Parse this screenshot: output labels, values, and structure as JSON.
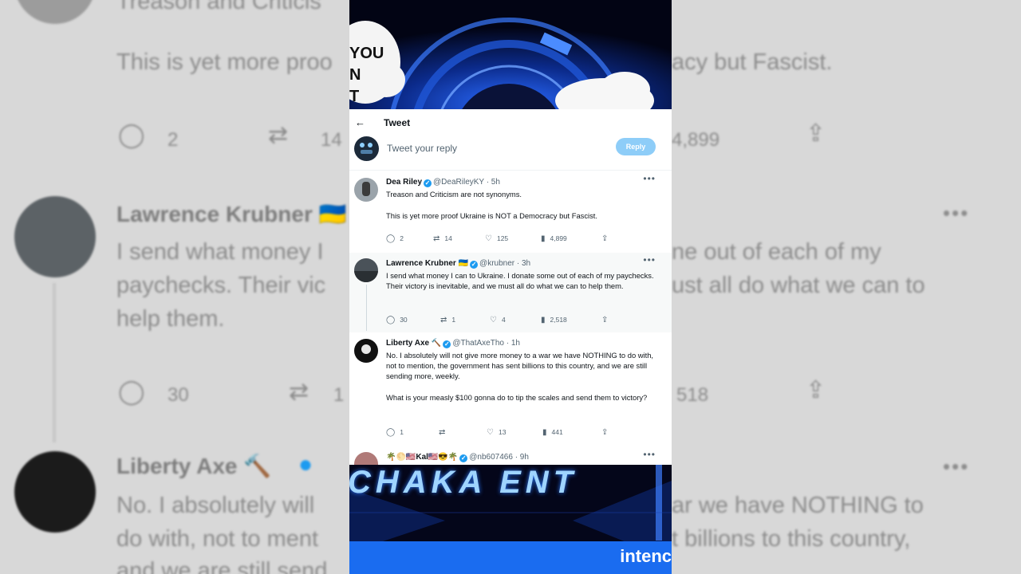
{
  "header": {
    "title": "Tweet",
    "back_icon": "arrow-left-icon"
  },
  "reply": {
    "placeholder": "Tweet your reply",
    "button_label": "Reply",
    "button_color": "#8ecdf8"
  },
  "tweets": [
    {
      "name": "Dea Riley",
      "handle": "@DeaRileyKY · 5h",
      "text_1": "Treason and Criticism are not synonyms.",
      "text_2": "This is yet more proof Ukraine is NOT a Democracy but Fascist.",
      "replies": "2",
      "retweets": "14",
      "likes": "125",
      "views": "4,899"
    },
    {
      "name": "Lawrence Krubner 🇺🇦",
      "handle": "@krubner · 3h",
      "text_1": "I send what money I can to Ukraine. I donate some out of each of my paychecks. Their victory is inevitable, and we must all do what we can to help them.",
      "replies": "30",
      "retweets": "1",
      "likes": "4",
      "views": "2,518"
    },
    {
      "name": "Liberty Axe 🔨",
      "handle": "@ThatAxeTho · 1h",
      "text_1": "No. I absolutely will not give more money to a war we have NOTHING to do with, not to mention, the government has sent billions to this country, and we are still sending more, weekly.",
      "text_2": "What is your measly $100 gonna do to tip the scales and send them to victory?",
      "replies": "1",
      "retweets": "",
      "likes": "13",
      "views": "441"
    },
    {
      "name": "🌴🌕🇺🇸Kal🇺🇸😎🌴",
      "handle": "@nb607466 · 9h"
    }
  ],
  "banner": {
    "text": "YOU\nN\nT"
  },
  "footer": {
    "brand": "CHAKA ENT",
    "cta": "intenc",
    "cta_bg": "#1a6cf0"
  },
  "background": {
    "line_1": "Treason and Criticis",
    "line_2": "This is yet more proo",
    "line_2b": "acy but Fascist.",
    "stat_1": "2",
    "stat_2": "14",
    "stat_3": "4,899",
    "name_2": "Lawrence Krubner 🇺🇦",
    "body_2a": "I send what money I",
    "body_2a_r": "ne out of each of my",
    "body_2b": "paychecks. Their vic",
    "body_2b_r": "ust all do what we can to",
    "body_2c": "help them.",
    "stat_4": "30",
    "stat_5": "1",
    "stat_6": "518",
    "name_3": "Liberty Axe 🔨",
    "body_3a": "No. I absolutely will",
    "body_3a_r": "ar we have NOTHING to",
    "body_3b": "do with, not to ment",
    "body_3b_r": "t billions to this country,",
    "body_3c": "and we are still send"
  }
}
